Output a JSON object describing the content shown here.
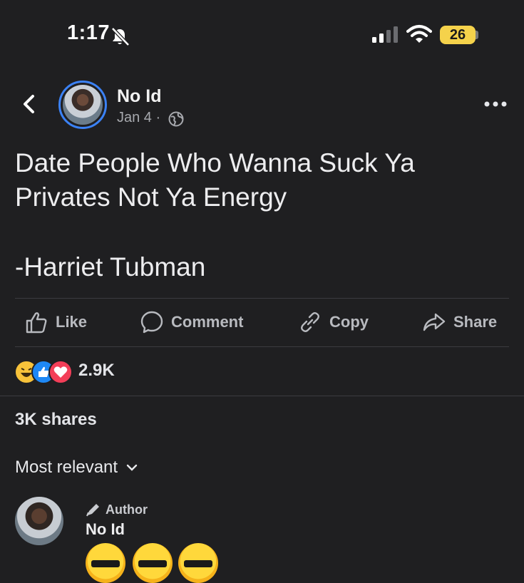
{
  "status_bar": {
    "time": "1:17",
    "battery": "26",
    "icons": [
      "bell-slash-icon",
      "signal-icon",
      "wifi-icon",
      "battery-icon"
    ]
  },
  "header": {
    "author_name": "No Id",
    "date": "Jan 4 ·",
    "privacy_icon": "globe-icon",
    "back_icon": "chevron-left-icon",
    "more_icon": "more-horizontal-icon"
  },
  "post": {
    "text_lines": [
      "Date People Who Wanna Suck Ya",
      "Privates Not Ya Energy"
    ],
    "attribution": "-Harriet Tubman"
  },
  "actions": {
    "like": "Like",
    "comment": "Comment",
    "copy": "Copy",
    "share": "Share"
  },
  "reactions": {
    "types": [
      "haha",
      "like",
      "love"
    ],
    "count": "2.9K"
  },
  "shares": "3K shares",
  "comments": {
    "sort_label": "Most relevant",
    "first": {
      "badge": "Author",
      "name": "No Id",
      "emoji_count": 3
    }
  },
  "colors": {
    "background": "#1f1f21",
    "accent_blue": "#3b82f6",
    "battery_yellow": "#f5d24b",
    "divider": "#3b3c40"
  }
}
